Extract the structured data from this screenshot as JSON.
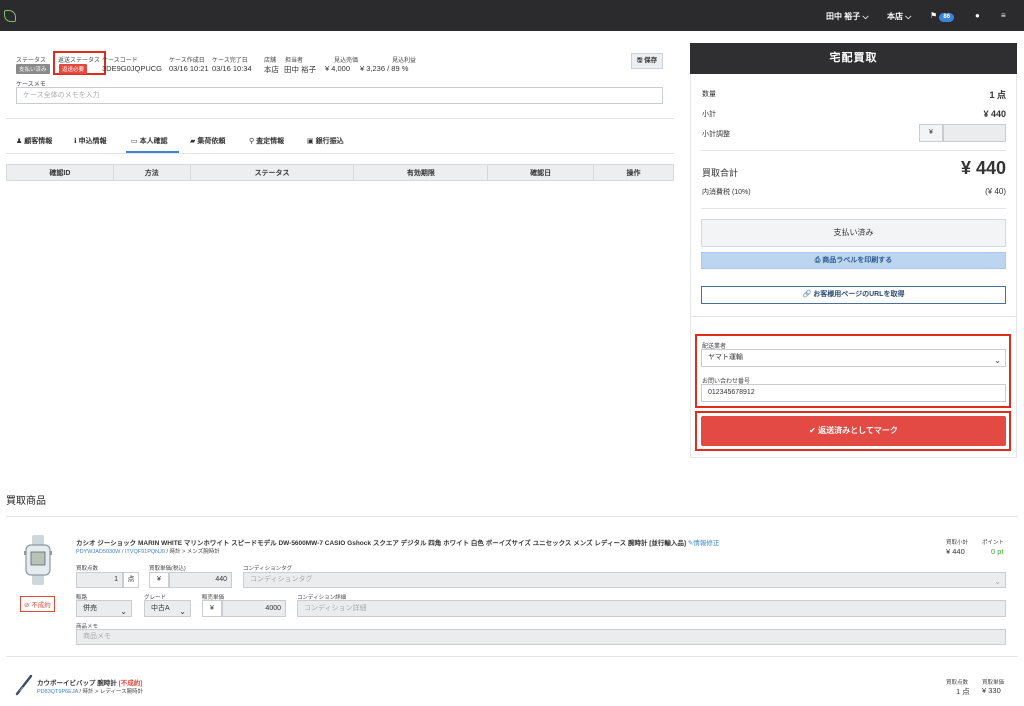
{
  "topbar": {
    "user": "田中 裕子",
    "store": "本店",
    "notification_count": "86"
  },
  "case": {
    "labels": {
      "status": "ステータス",
      "return_status": "返送ステータス",
      "case_code": "ケースコード",
      "created": "ケース作成日",
      "completed": "ケース完了日",
      "store": "店舗",
      "staff": "担当者",
      "estimate": "見込売価",
      "profit": "見込利益"
    },
    "status_tag": "支払い済み",
    "return_status_tag": "返送必要",
    "case_code": "3DE9G0JQPUCG",
    "created": "03/16 10:21",
    "completed": "03/16 10:34",
    "store": "本店",
    "staff": "田中 裕子",
    "estimate": "¥ 4,000",
    "profit": "¥ 3,236 / 89 %",
    "save_label": "保存",
    "memo_label": "ケースメモ",
    "memo_placeholder": "ケース全体のメモを入力"
  },
  "tabs": [
    {
      "label": "顧客情報",
      "icon": "user-icon"
    },
    {
      "label": "申込情報",
      "icon": "info-icon"
    },
    {
      "label": "本人確認",
      "icon": "id-card-icon"
    },
    {
      "label": "集荷依頼",
      "icon": "truck-icon"
    },
    {
      "label": "査定情報",
      "icon": "search-icon"
    },
    {
      "label": "銀行振込",
      "icon": "money-icon"
    }
  ],
  "verify_table": {
    "headers": [
      "確認ID",
      "方法",
      "ステータス",
      "有効期限",
      "確認日",
      "操作"
    ]
  },
  "panel": {
    "title": "宅配買取",
    "qty_label": "数量",
    "qty_value": "1 点",
    "subtotal_label": "小計",
    "subtotal_value": "¥ 440",
    "adjust_label": "小計調整",
    "yen": "¥",
    "total_label": "買取合計",
    "total_value": "¥ 440",
    "tax_label": "内消費税 (10%)",
    "tax_value": "(¥ 40)",
    "paid_button": "支払い済み",
    "print_button": "商品ラベルを印刷する",
    "url_button": "お客様用ページのURLを取得",
    "carrier_label": "配送業者",
    "carrier_value": "ヤマト運輸",
    "tracking_label": "お問い合わせ番号",
    "tracking_value": "012345678912",
    "mark_button": "返送済みとしてマーク"
  },
  "products": {
    "section_title": "買取商品",
    "items": [
      {
        "title": "カシオ ジーショック MARIN WHITE マリンホワイト スピードモデル DW-5600MW-7 CASIO Gshock スクエア デジタル 四角 ホワイト 白色 ボーイズサイズ ユニセックス メンズ レディース 腕時計 [並行輸入品]",
        "edit_label": "情報修正",
        "codes": "PDYWJAD5030W / ITVQF91PQNJ0",
        "category": " / 時計 > メンズ腕時計",
        "not_established": "不成約",
        "qty_label": "買取点数",
        "qty_value": "1",
        "qty_unit": "点",
        "price_label": "買取単価(税込)",
        "yen": "¥",
        "price_value": "440",
        "condtag_label": "コンディションタグ",
        "condtag_placeholder": "コンディションタグ",
        "channel_label": "販路",
        "channel_value": "併売",
        "grade_label": "グレード",
        "grade_value": "中古A",
        "sale_label": "販売単価",
        "sale_value": "4000",
        "cond_detail_label": "コンディション詳細",
        "cond_detail_placeholder": "コンディション詳細",
        "memo_label": "商品メモ",
        "memo_placeholder": "商品メモ",
        "subtotal_label": "買取小計",
        "subtotal_value": "¥ 440",
        "point_label": "ポイント",
        "point_value": "0 pt"
      },
      {
        "title": "カウボーイビバップ 腕時計",
        "status": "[不成約]",
        "codes": "PD83QT9P6EJA",
        "category": " / 時計 > レディース腕時計",
        "qty_label": "買取点数",
        "qty_value": "1 点",
        "price_label": "買取単価",
        "price_value": "¥ 330"
      }
    ]
  }
}
